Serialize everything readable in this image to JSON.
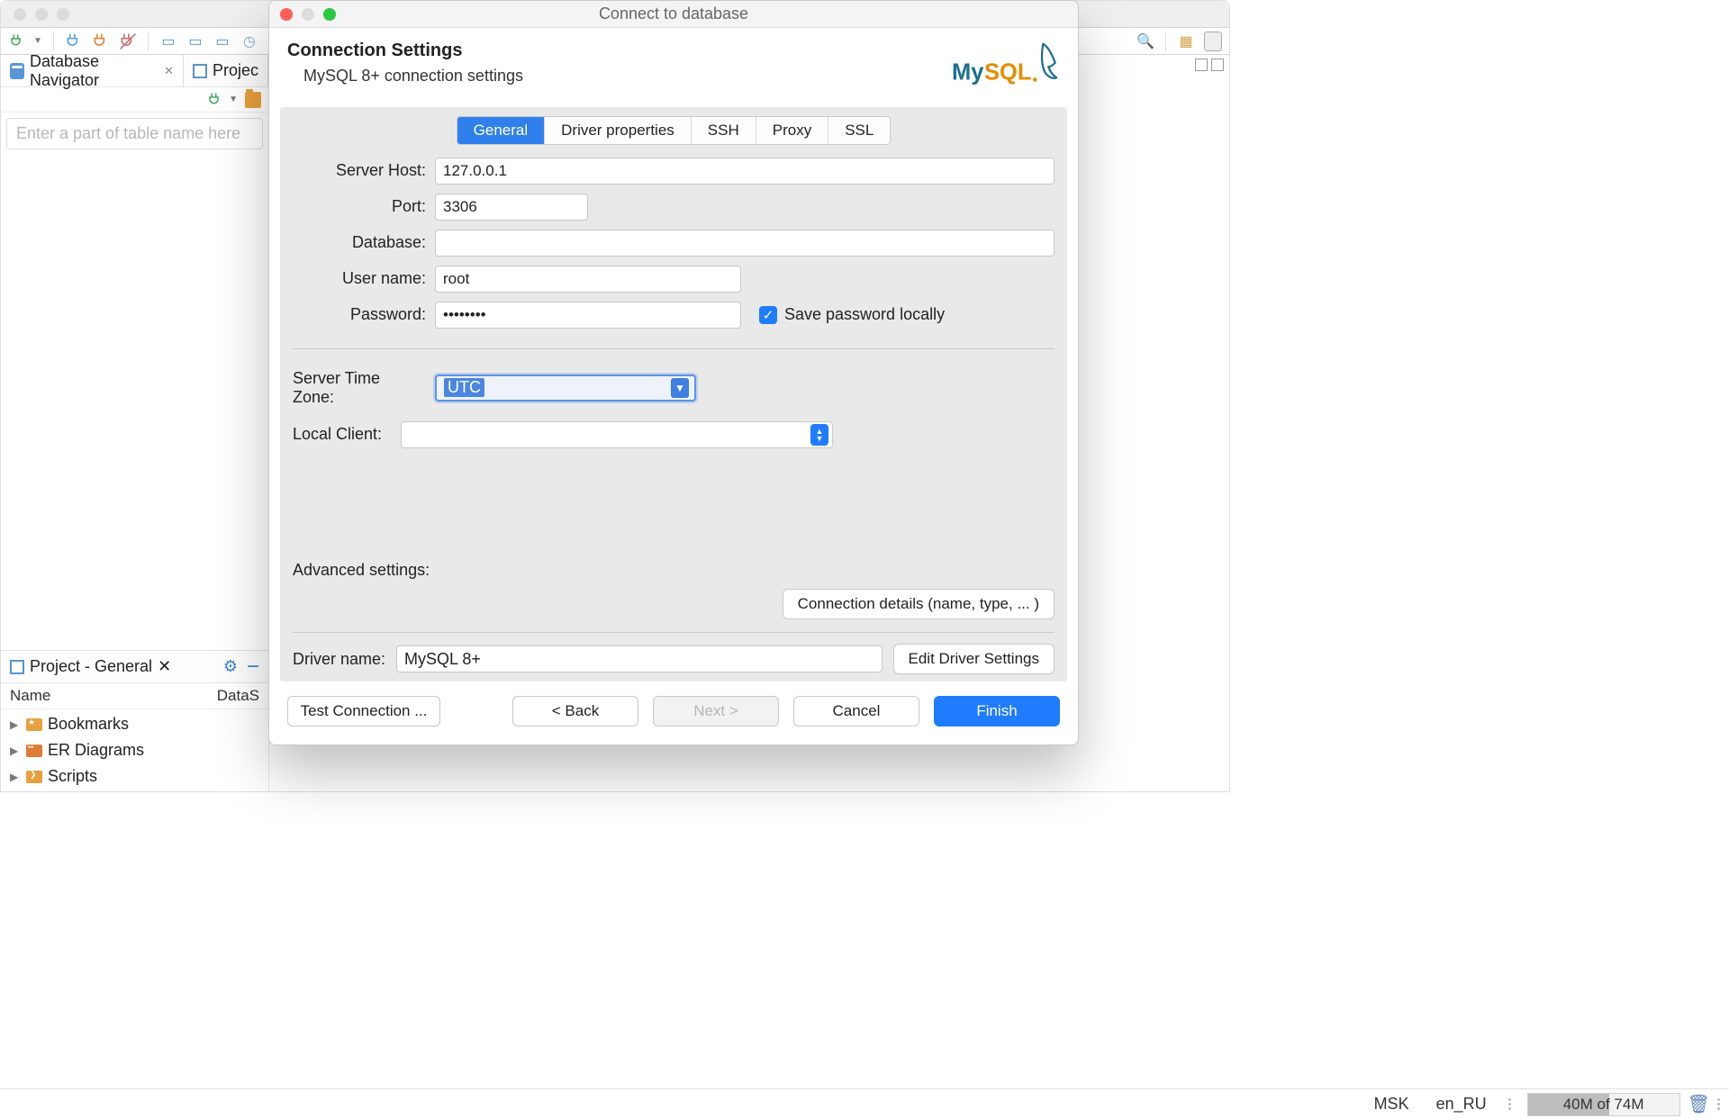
{
  "ide": {
    "navigator_tab": "Database Navigator",
    "projects_tab": "Projec",
    "filter_placeholder": "Enter a part of table name here",
    "project_panel": {
      "title": "Project - General",
      "cols": {
        "name": "Name",
        "datasource": "DataS"
      },
      "tree": [
        {
          "label": "Bookmarks"
        },
        {
          "label": "ER Diagrams"
        },
        {
          "label": "Scripts"
        }
      ]
    }
  },
  "status": {
    "tz": "MSK",
    "locale": "en_RU",
    "mem": "40M of 74M"
  },
  "dialog": {
    "title": "Connect to database",
    "heading": "Connection Settings",
    "subheading": "MySQL 8+ connection settings",
    "logo_text": "MySQL",
    "tabs": {
      "general": "General",
      "driver_props": "Driver properties",
      "ssh": "SSH",
      "proxy": "Proxy",
      "ssl": "SSL"
    },
    "fields": {
      "server_host_label": "Server Host:",
      "server_host_value": "127.0.0.1",
      "port_label": "Port:",
      "port_value": "3306",
      "database_label": "Database:",
      "database_value": "",
      "user_label": "User name:",
      "user_value": "root",
      "password_label": "Password:",
      "password_value": "••••••••",
      "save_pwd_label": "Save password locally",
      "tz_label": "Server Time Zone:",
      "tz_value": "UTC",
      "local_client_label": "Local Client:",
      "local_client_value": ""
    },
    "advanced": {
      "header": "Advanced settings:",
      "conn_details_btn": "Connection details (name, type, ... )",
      "driver_name_label": "Driver name:",
      "driver_name_value": "MySQL 8+",
      "edit_driver_btn": "Edit Driver Settings"
    },
    "buttons": {
      "test": "Test Connection ...",
      "back": "< Back",
      "next": "Next >",
      "cancel": "Cancel",
      "finish": "Finish"
    }
  }
}
